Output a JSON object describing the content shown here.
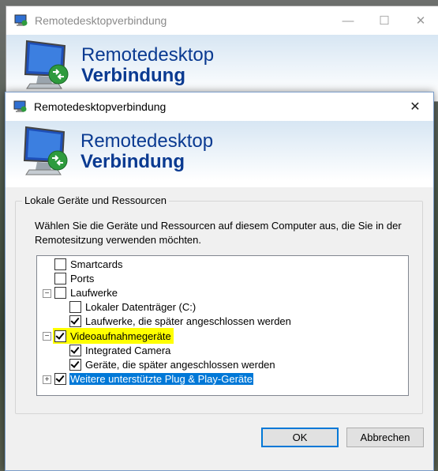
{
  "back_window": {
    "title": "Remotedesktopverbindung",
    "banner_line1": "Remotedesktop",
    "banner_line2": "Verbindung",
    "minimize": "—",
    "maximize": "☐",
    "close": "✕"
  },
  "dialog": {
    "title": "Remotedesktopverbindung",
    "close": "✕",
    "banner_line1": "Remotedesktop",
    "banner_line2": "Verbindung",
    "group_title": "Lokale Geräte und Ressourcen",
    "description": "Wählen Sie die Geräte und Ressourcen auf diesem Computer aus, die Sie in der Remotesitzung verwenden möchten.",
    "tree": [
      {
        "label": "Smartcards",
        "checked": false,
        "expander": ""
      },
      {
        "label": "Ports",
        "checked": false,
        "expander": ""
      },
      {
        "label": "Laufwerke",
        "checked": false,
        "expander": "−"
      },
      {
        "label": "Lokaler Datenträger (C:)",
        "checked": false,
        "expander": ""
      },
      {
        "label": "Laufwerke, die später angeschlossen werden",
        "checked": true,
        "expander": ""
      },
      {
        "label": "Videoaufnahmegeräte",
        "checked": true,
        "expander": "−"
      },
      {
        "label": "Integrated Camera",
        "checked": true,
        "expander": ""
      },
      {
        "label": "Geräte, die später angeschlossen werden",
        "checked": true,
        "expander": ""
      },
      {
        "label": "Weitere unterstützte Plug & Play-Geräte",
        "checked": true,
        "expander": "+"
      }
    ],
    "ok_label": "OK",
    "cancel_label": "Abbrechen"
  },
  "colors": {
    "banner_text": "#0a3a91",
    "highlight": "#ffff00",
    "selection": "#0078d7"
  }
}
